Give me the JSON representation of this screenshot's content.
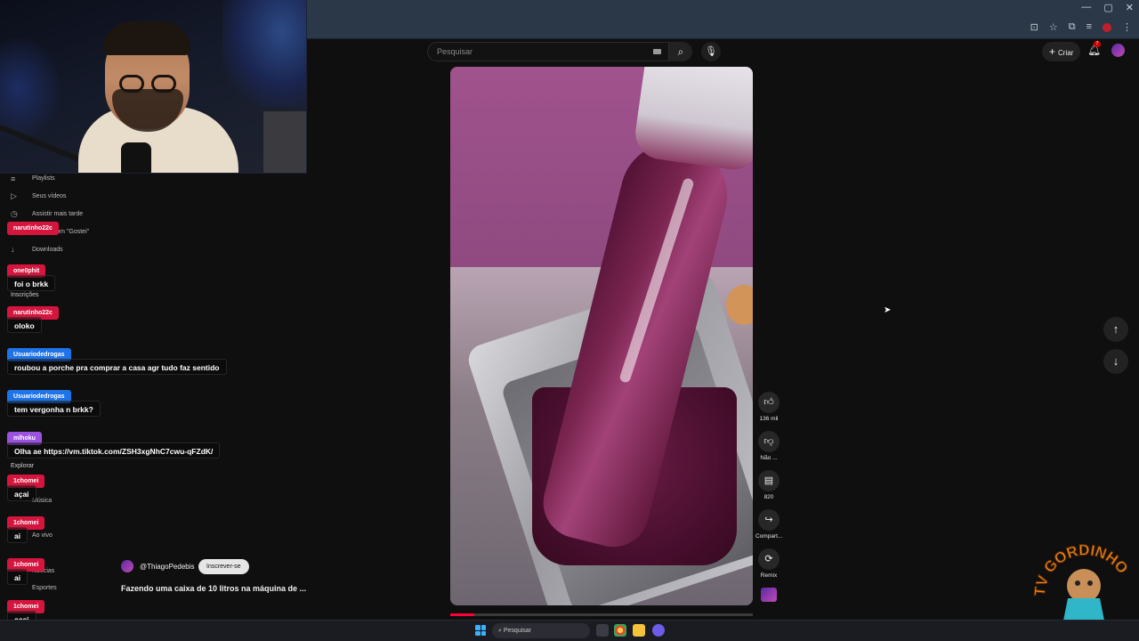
{
  "browser": {
    "window_controls": [
      "—",
      "▢",
      "✕"
    ]
  },
  "youtube": {
    "search_placeholder": "Pesquisar",
    "create_label": "Criar",
    "notification_count": "7"
  },
  "sidebar_ghost": {
    "items": [
      {
        "label": "Playlists",
        "icon": "playlist-icon"
      },
      {
        "label": "Seus vídeos",
        "icon": "video-icon"
      },
      {
        "label": "Assistir mais tarde",
        "icon": "clock-icon"
      },
      {
        "label": "Vídeos com \"Gostei\"",
        "icon": "thumb-up-icon"
      },
      {
        "label": "Downloads",
        "icon": "download-icon"
      },
      {
        "label": "Inscrições",
        "icon": ""
      },
      {
        "label": "Explorar",
        "icon": ""
      },
      {
        "label": "Música",
        "icon": "music-icon"
      },
      {
        "label": "Ao vivo",
        "icon": "live-icon"
      },
      {
        "label": "Notícias",
        "icon": "news-icon"
      },
      {
        "label": "Esportes",
        "icon": "trophy-icon"
      }
    ]
  },
  "chat": [
    {
      "user": "narutinho22c",
      "color": "#d6153e",
      "text": ""
    },
    {
      "user": "one0phit",
      "color": "#d6153e",
      "text": "foi o brkk"
    },
    {
      "user": "narutinho22c",
      "color": "#d6153e",
      "text": "oloko"
    },
    {
      "user": "Usuariodedrogas",
      "color": "#1e73e8",
      "text": "roubou a porche pra comprar a casa agr tudo faz sentido"
    },
    {
      "user": "Usuariodedrogas",
      "color": "#1e73e8",
      "text": "tem vergonha n brkk?"
    },
    {
      "user": "mlhoku",
      "color": "#9b52e0",
      "text": "Olha ae https://vm.tiktok.com/ZSH3xgNhC7cwu-qFZdK/"
    },
    {
      "user": "1chomei",
      "color": "#d6153e",
      "text": "açai"
    },
    {
      "user": "1chomei",
      "color": "#d6153e",
      "text": "ai"
    },
    {
      "user": "1chomei",
      "color": "#d6153e",
      "text": "ai"
    },
    {
      "user": "1chomei",
      "color": "#d6153e",
      "text": "açai"
    }
  ],
  "video": {
    "channel": "@ThiagoPedebis",
    "subscribe_label": "Inscrever-se",
    "title": "Fazendo uma caixa de 10 litros na máquina de ...",
    "progress": 0.08
  },
  "actions": [
    {
      "icon": "like-icon",
      "label": "136 mil"
    },
    {
      "icon": "dislike-icon",
      "label": "Não ..."
    },
    {
      "icon": "comment-icon",
      "label": "820"
    },
    {
      "icon": "share-icon",
      "label": "Compart..."
    },
    {
      "icon": "remix-icon",
      "label": "Remix"
    }
  ],
  "taskbar": {
    "search_label": "Pesquisar"
  },
  "watermark": {
    "text": "TV GORDINHO"
  },
  "colors": {
    "accent": "#ff0033",
    "background": "#0f0f0f"
  }
}
